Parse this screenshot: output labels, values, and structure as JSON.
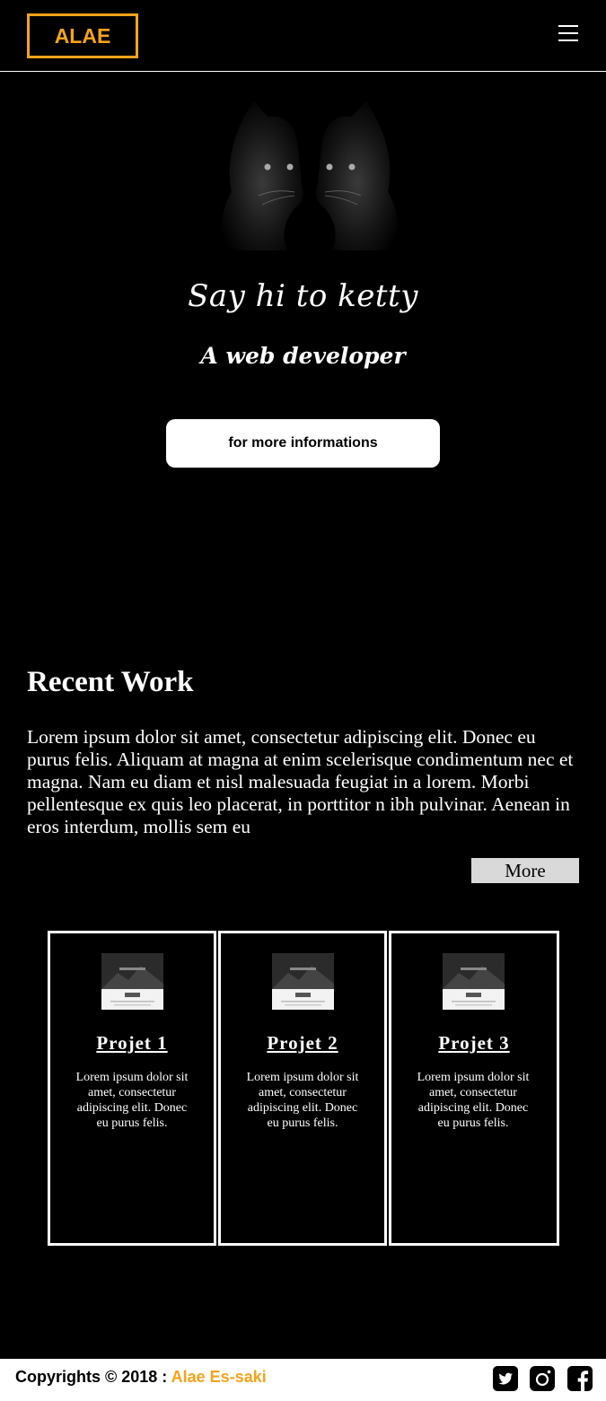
{
  "header": {
    "logo": "ALAE",
    "menu_icon": "hamburger-icon"
  },
  "hero": {
    "title": "Say hi to ketty",
    "subtitle": "A web developer",
    "button_label": "for more informations"
  },
  "recent_work": {
    "title": "Recent Work",
    "text": "Lorem ipsum dolor sit amet, consectetur adipiscing elit. Donec eu purus felis. Aliquam at magna at enim scelerisque condimentum nec et magna. Nam eu diam et nisl malesuada feugiat in a lorem. Morbi pellentesque ex quis leo placerat, in porttitor n ibh pulvinar. Aenean in eros interdum, mollis sem eu",
    "more_label": "More"
  },
  "projects": [
    {
      "title": "Projet 1",
      "description": "Lorem ipsum dolor sit amet, consectetur adipiscing elit. Donec eu purus felis."
    },
    {
      "title": "Projet 2",
      "description": "Lorem ipsum dolor sit amet, consectetur adipiscing elit. Donec eu purus felis."
    },
    {
      "title": "Projet 3",
      "description": "Lorem ipsum dolor sit amet, consectetur adipiscing elit. Donec eu purus felis."
    }
  ],
  "footer": {
    "copyright": "Copyrights © 2018 :",
    "author": "Alae Es-saki",
    "social_icons": [
      "twitter-icon",
      "instagram-icon",
      "facebook-icon"
    ]
  },
  "colors": {
    "accent": "#f5a31a",
    "background": "#000000",
    "button_bg": "#ffffff",
    "more_bg": "#d9d9d9"
  }
}
